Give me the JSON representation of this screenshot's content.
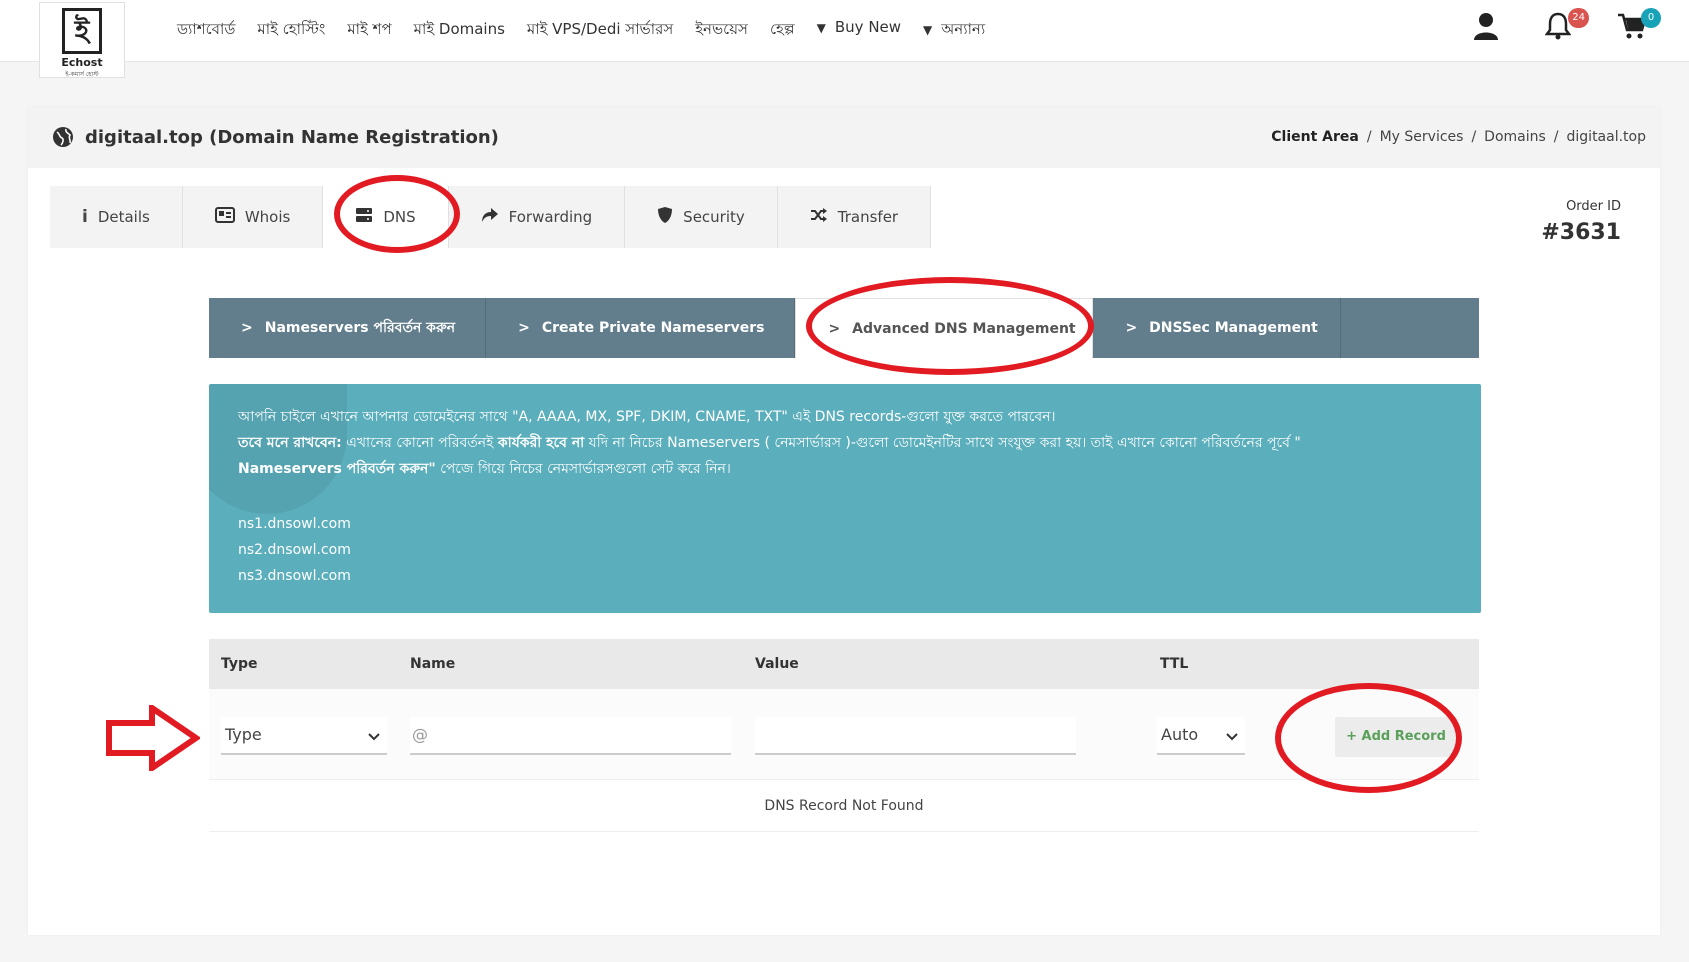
{
  "brand": {
    "name": "Echost",
    "glyph": "ই",
    "tagline": "ই-কমার্স হোস্ট"
  },
  "nav": {
    "items": [
      "ড্যাশবোর্ড",
      "মাই হোস্টিং",
      "মাই শপ",
      "মাই Domains",
      "মাই VPS/Dedi সার্ভারস",
      "ইনভয়েস",
      "হেল্প"
    ],
    "buy_new": "Buy New",
    "other": "অন্যান্য"
  },
  "header_icons": {
    "notifications_count": "24",
    "cart_count": "0"
  },
  "page": {
    "title": "digitaal.top (Domain Name Registration)",
    "breadcrumb": [
      "Client Area",
      "My Services",
      "Domains",
      "digitaal.top"
    ],
    "order_label": "Order ID",
    "order_id": "#3631"
  },
  "tabs": [
    "Details",
    "Whois",
    "DNS",
    "Forwarding",
    "Security",
    "Transfer"
  ],
  "active_tab": "DNS",
  "subtabs": [
    "Nameservers পরিবর্তন করুন",
    "Create Private Nameservers",
    "Advanced DNS Management",
    "DNSSec Management"
  ],
  "active_subtab": "Advanced DNS Management",
  "info": {
    "line1": "আপনি চাইলে এখানে আপনার ডোমেইনের সাথে \"A, AAAA, MX, SPF, DKIM, CNAME, TXT\" এই DNS records-গুলো যুক্ত করতে পারবেন।",
    "line2_bold": "তবে মনে রাখবেন:",
    "line2_a": " এখানের কোনো পরিবর্তনই ",
    "line2_bold2": "কার্যকরী হবে না",
    "line2_b": " যদি না নিচের Nameservers ( নেমসার্ভারস )-গুলো ডোমেইনটির সাথে সংযুক্ত করা হয়। তাই এখানে কোনো পরিবর্তনের পূর্বে \"",
    "line3_bold": "Nameservers পরিবর্তন করুন\"",
    "line3": " পেজে গিয়ে নিচের নেমসার্ভারসগুলো সেট করে নিন।",
    "nameservers": [
      "ns1.dnsowl.com",
      "ns2.dnsowl.com",
      "ns3.dnsowl.com"
    ]
  },
  "dns_table": {
    "headers": {
      "type": "Type",
      "name": "Name",
      "value": "Value",
      "ttl": "TTL"
    },
    "type_select": "Type",
    "name_placeholder": "@",
    "value_placeholder": "",
    "ttl_select": "Auto",
    "add_button": "+ Add Record",
    "empty_message": "DNS Record Not Found"
  },
  "annotation_color": "#e21b23",
  "colors": {
    "subtab_bg": "#627d8b",
    "info_bg": "#5baebb",
    "badge_red": "#d9534f",
    "badge_teal": "#17a2b8"
  }
}
